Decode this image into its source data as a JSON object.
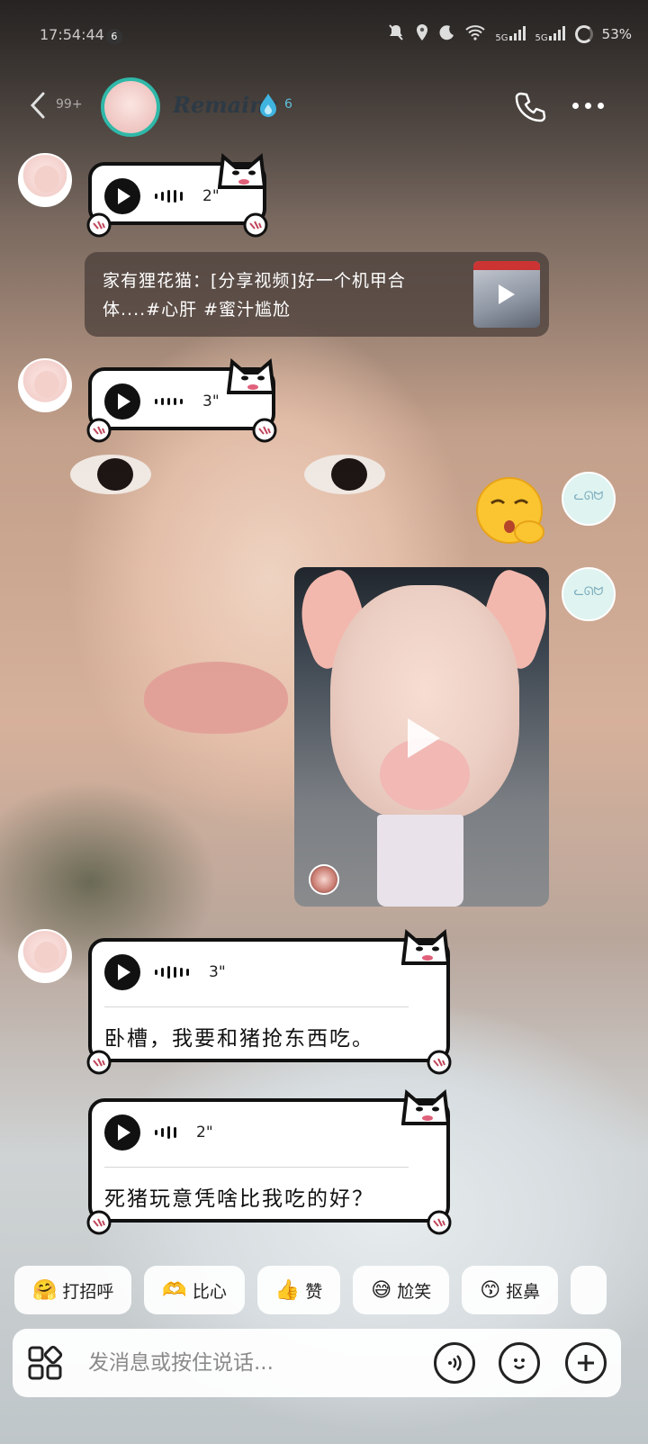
{
  "status_bar": {
    "time": "17:54:44",
    "notification_count": "6",
    "battery": "53%",
    "signal_1": "5G",
    "signal_2": "5G"
  },
  "header": {
    "back_count": "99+",
    "contact_name": "Remains",
    "streak_count": "6"
  },
  "messages": {
    "voice1": {
      "duration": "2\""
    },
    "shared": {
      "text": "家有狸花猫：[分享视频]好一个机甲合体....#心肝 #蜜汁尴尬"
    },
    "voice2": {
      "duration": "3\""
    },
    "voice3": {
      "duration": "3\"",
      "transcript": "卧槽，我要和猪抢东西吃。"
    },
    "voice4": {
      "duration": "2\"",
      "transcript": "死猪玩意凭啥比我吃的好？"
    }
  },
  "quick_replies": [
    {
      "icon": "hug-emoji",
      "label": "打招呼"
    },
    {
      "icon": "heart-hands-emoji",
      "label": "比心"
    },
    {
      "icon": "thumbs-up-emoji",
      "label": "赞"
    },
    {
      "icon": "sweat-smile-emoji",
      "label": "尬笑"
    },
    {
      "icon": "nose-pick-emoji",
      "label": "抠鼻"
    }
  ],
  "input": {
    "placeholder": "发消息或按住说话..."
  },
  "colors": {
    "avatar_ring": "#2fb8a8",
    "streak_drop": "#3fb4e0",
    "bubble_border": "#111111"
  }
}
